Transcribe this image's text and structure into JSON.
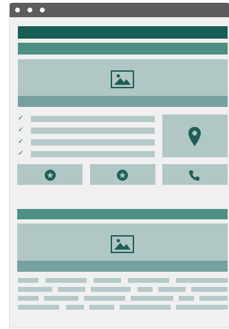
{
  "window": {
    "controls": [
      "close-dot",
      "minimize-dot",
      "maximize-dot"
    ]
  },
  "icons": {
    "hero_image": "image-icon",
    "location": "map-pin-icon",
    "feature_1": "star-icon",
    "feature_2": "star-icon",
    "contact": "phone-icon",
    "second_image": "image-icon",
    "check": "checkmark-icon"
  },
  "colors": {
    "titlebar": "#5d5d5d",
    "header_dark": "#165e56",
    "header_mid": "#4c8f83",
    "panel_light": "#b1c7c6",
    "panel_strip": "#75a2a0",
    "icon": "#1f5e57",
    "background": "#f0f0f0"
  },
  "checklist_items": 4,
  "footer_text_rows": 4
}
